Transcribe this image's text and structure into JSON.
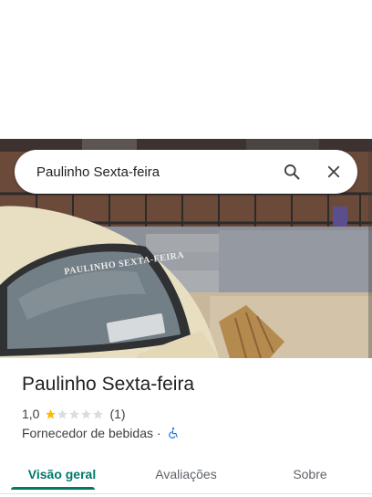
{
  "search": {
    "query": "Paulinho Sexta-feira",
    "search_icon": "search-icon",
    "close_icon": "close-icon"
  },
  "photo": {
    "car_window_text": "PAULINHO SEXTA-FEIRA"
  },
  "place": {
    "name": "Paulinho Sexta-feira",
    "rating": "1,0",
    "rating_value": 1,
    "rating_max": 5,
    "review_count": "(1)",
    "category": "Fornecedor de bebidas",
    "separator": "·",
    "accessibility_icon": "wheelchair-icon"
  },
  "tabs": [
    {
      "label": "Visão geral",
      "active": true
    },
    {
      "label": "Avaliações",
      "active": false
    },
    {
      "label": "Sobre",
      "active": false
    }
  ],
  "colors": {
    "accent": "#00796b",
    "star_filled": "#fbbc04",
    "star_empty": "#dadce0",
    "a11y_blue": "#1a73e8"
  }
}
